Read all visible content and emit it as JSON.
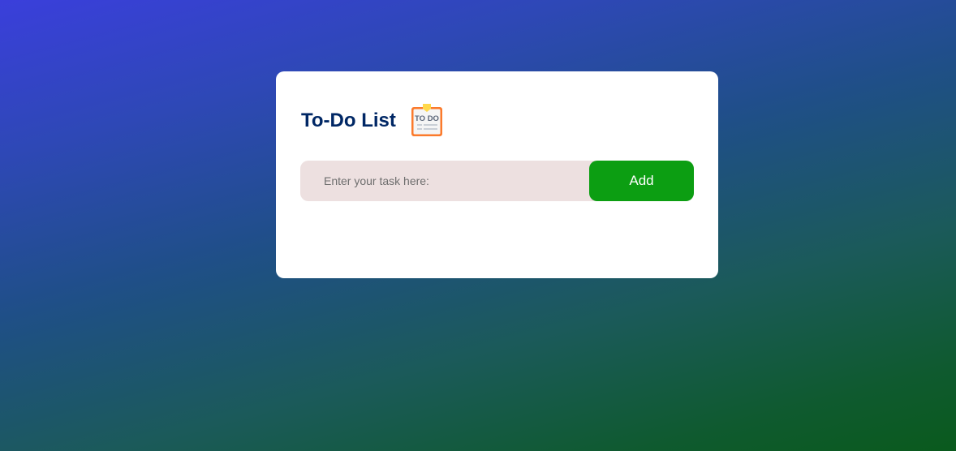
{
  "app": {
    "title": "To-Do List",
    "icon": "todo-clipboard-icon",
    "icon_text": "TO DO"
  },
  "task_input": {
    "value": "",
    "placeholder": "Enter your task here:"
  },
  "add_button": {
    "label": "Add"
  },
  "colors": {
    "title": "#002765",
    "add_button": "#0c9e12",
    "input_background": "#ede0e0",
    "card_background": "#ffffff",
    "gradient_top": "#3a3fdb",
    "gradient_bottom": "#0a5a1d"
  },
  "tasks": []
}
